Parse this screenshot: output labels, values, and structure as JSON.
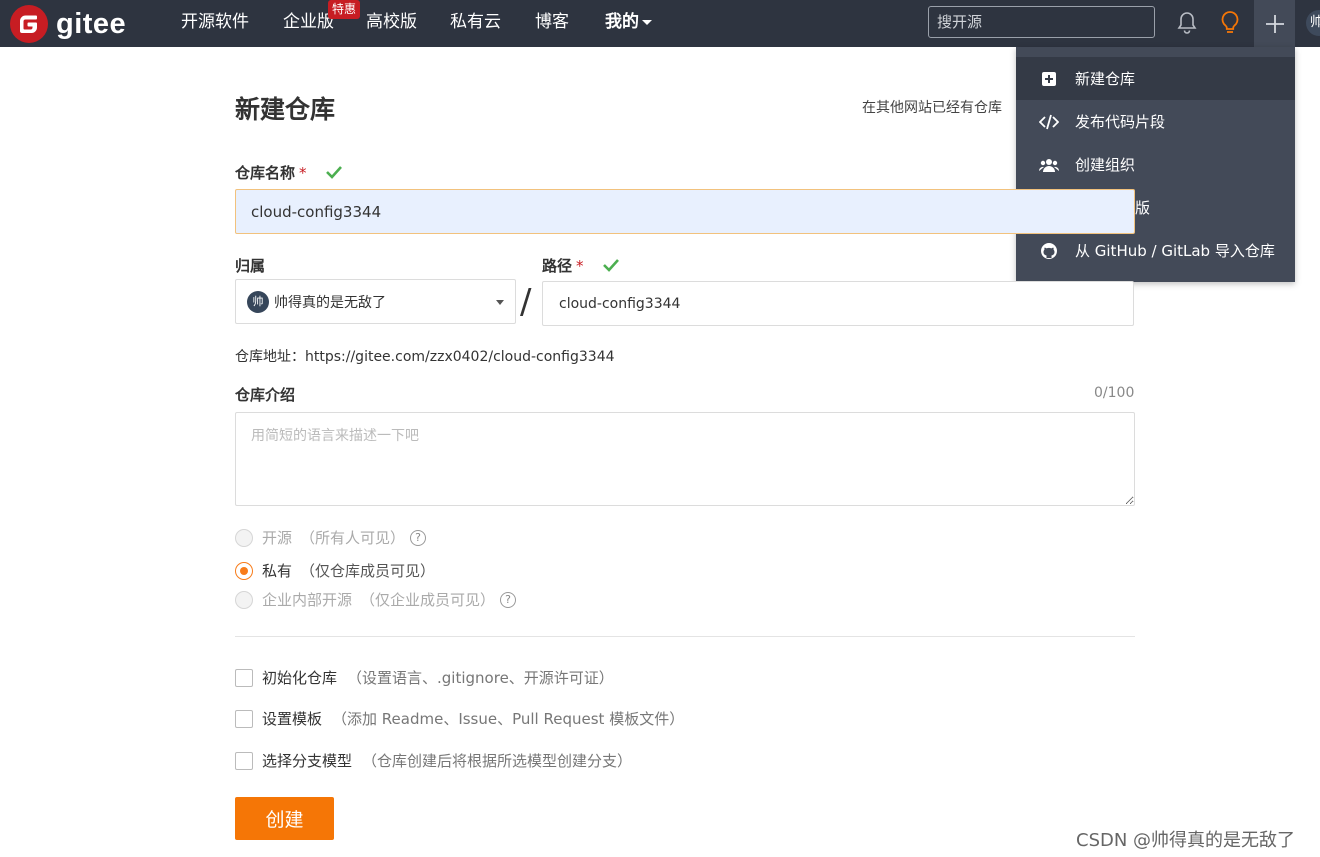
{
  "nav": {
    "brand": "gitee",
    "items": [
      {
        "label": "开源软件"
      },
      {
        "label": "企业版"
      },
      {
        "label": "高校版"
      },
      {
        "label": "私有云"
      },
      {
        "label": "博客"
      },
      {
        "label": "我的"
      }
    ],
    "hot_badge": "特惠",
    "search_placeholder": "搜开源",
    "avatar_char": "帅"
  },
  "dropdown": {
    "items": [
      {
        "label": "新建仓库",
        "icon": "plus-square-icon"
      },
      {
        "label": "发布代码片段",
        "icon": "code-icon"
      },
      {
        "label": "创建组织",
        "icon": "users-icon"
      },
      {
        "label": "开通企业版",
        "icon": "building-icon"
      },
      {
        "label": "从 GitHub / GitLab 导入仓库",
        "icon": "github-icon"
      }
    ]
  },
  "form": {
    "title": "新建仓库",
    "import_hint": "在其他网站已经有仓库",
    "name_label": "仓库名称",
    "name_value": "cloud-config3344",
    "owner_label": "归属",
    "owner_value": "帅得真的是无敌了",
    "owner_avatar": "帅",
    "slash": "/",
    "path_label": "路径",
    "path_value": "cloud-config3344",
    "required_mark": "*",
    "repo_url": "仓库地址：https://gitee.com/zzx0402/cloud-config3344",
    "desc_label": "仓库介绍",
    "desc_counter": "0/100",
    "desc_placeholder": "用简短的语言来描述一下吧",
    "visibility": [
      {
        "label": "开源",
        "note": "（所有人可见）",
        "selected": false,
        "disabled": true,
        "help": "?"
      },
      {
        "label": "私有",
        "note": "（仅仓库成员可见）",
        "selected": true,
        "disabled": false
      },
      {
        "label": "企业内部开源",
        "note": "（仅企业成员可见）",
        "selected": false,
        "disabled": true,
        "help": "?"
      }
    ],
    "options": [
      {
        "label": "初始化仓库",
        "note": "（设置语言、.gitignore、开源许可证）",
        "checked": false
      },
      {
        "label": "设置模板",
        "note": "（添加 Readme、Issue、Pull Request 模板文件）",
        "checked": false
      },
      {
        "label": "选择分支模型",
        "note": "（仓库创建后将根据所选模型创建分支）",
        "checked": false
      }
    ],
    "submit_label": "创建"
  },
  "watermark": "CSDN @帅得真的是无敌了",
  "colors": {
    "accent": "#f57606",
    "nav_bg": "#2e3440",
    "brand_red": "#c71d23",
    "valid_green": "#4caf50"
  }
}
